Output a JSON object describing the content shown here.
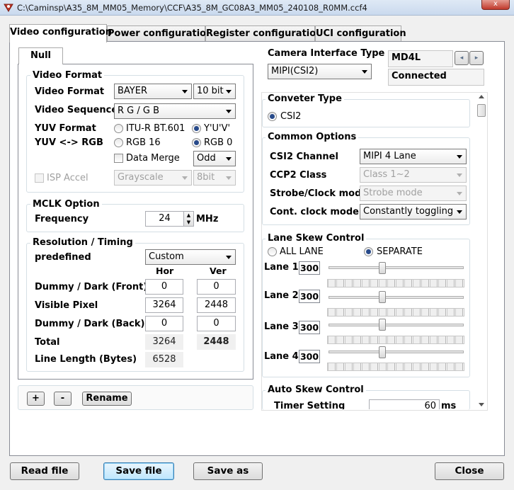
{
  "window": {
    "title": "C:\\Caminsp\\A35_8M_MM05_Memory\\CCF\\A35_8M_GC08A3_MM05_240108_R0MM.ccf4",
    "close": "x"
  },
  "tabs": [
    {
      "label": "Video configuration",
      "active": true
    },
    {
      "label": "Power configuration"
    },
    {
      "label": "Register configuration"
    },
    {
      "label": "UCI configuration"
    }
  ],
  "sensor_tab": "Null",
  "video_format": {
    "group_title": "Video Format",
    "format_label": "Video Format",
    "format_value": "BAYER",
    "bit_value": "10 bit",
    "sequence_label": "Video Sequence",
    "sequence_value": "R G / G B",
    "yuv_format_label": "YUV Format",
    "yuv_rgb_label": "YUV <-> RGB",
    "itu_label": "ITU-R BT.601",
    "yuv_order_label": "Y'U'V'",
    "rgb16_label": "RGB 16",
    "rgb0_label": "RGB 0",
    "data_merge_label": "Data Merge",
    "merge_value": "Odd",
    "isp_accel_label": "ISP Accel",
    "grayscale_value": "Grayscale",
    "bit8_value": "8bit"
  },
  "mclk": {
    "group_title": "MCLK Option",
    "frequency_label": "Frequency",
    "frequency_value": "24",
    "unit": "MHz"
  },
  "resolution": {
    "group_title": "Resolution / Timing",
    "predefined_label": "predefined",
    "predefined_value": "Custom",
    "hor_header": "Hor",
    "ver_header": "Ver",
    "rows": [
      {
        "label": "Dummy / Dark (Front)",
        "hor": "0",
        "ver": "0"
      },
      {
        "label": "Visible Pixel",
        "hor": "3264",
        "ver": "2448"
      },
      {
        "label": "Dummy / Dark (Back)",
        "hor": "0",
        "ver": "0"
      },
      {
        "label": "Total",
        "hor": "3264",
        "ver": "2448"
      }
    ],
    "line_length_label": "Line Length (Bytes)",
    "line_length_value": "6528"
  },
  "sensor_buttons": {
    "add": "+",
    "remove": "-",
    "rename": "Rename"
  },
  "camera_interface": {
    "title": "Camera Interface Type",
    "value": "MIPI(CSI2)"
  },
  "device": {
    "name": "MD4L",
    "status": "Connected",
    "prev": "◂",
    "next": "▸"
  },
  "converter": {
    "group_title": "Conveter Type",
    "option": "CSI2"
  },
  "common": {
    "group_title": "Common Options",
    "rows": [
      {
        "label": "CSI2 Channel",
        "value": "MIPI 4 Lane",
        "enabled": true
      },
      {
        "label": "CCP2 Class",
        "value": "Class 1~2",
        "enabled": false
      },
      {
        "label": "Strobe/Clock mode",
        "value": "Strobe mode",
        "enabled": false
      },
      {
        "label": "Cont. clock mode",
        "value": "Constantly toggling",
        "enabled": true
      }
    ]
  },
  "lane_skew": {
    "group_title": "Lane Skew Control",
    "all_lane": "ALL LANE",
    "separate": "SEPARATE",
    "lanes": [
      {
        "label": "Lane 1",
        "value": "300"
      },
      {
        "label": "Lane 2",
        "value": "300"
      },
      {
        "label": "Lane 3",
        "value": "300"
      },
      {
        "label": "Lane 4",
        "value": "300"
      }
    ]
  },
  "auto_skew": {
    "group_title": "Auto Skew Control",
    "timer_label": "Timer Setting",
    "timer_value": "60",
    "unit": "ms"
  },
  "footer": {
    "read": "Read file",
    "save": "Save file",
    "save_as": "Save as",
    "close": "Close"
  }
}
